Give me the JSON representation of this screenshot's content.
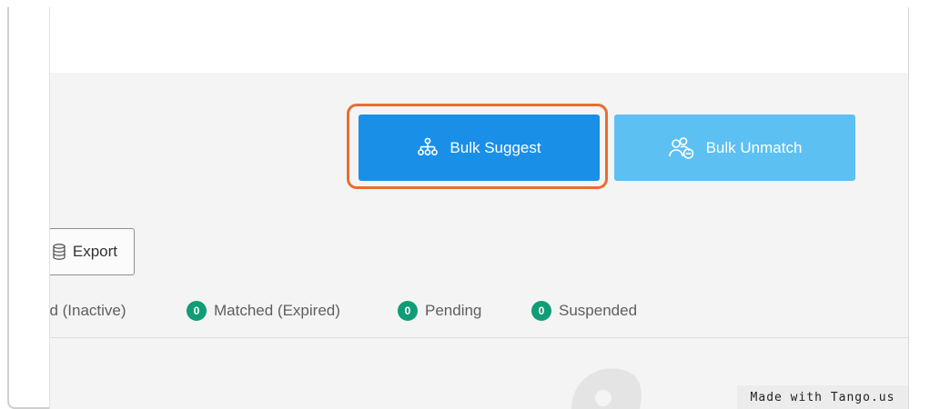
{
  "toolbar": {
    "bulk_suggest_label": "Bulk Suggest",
    "bulk_unmatch_label": "Bulk Unmatch",
    "export_label": "Export"
  },
  "status_filters": [
    {
      "label": "ed (Inactive)"
    },
    {
      "count": "0",
      "label": "Matched (Expired)"
    },
    {
      "count": "0",
      "label": "Pending"
    },
    {
      "count": "0",
      "label": "Suspended"
    }
  ],
  "footer": {
    "watermark_text": "Made with Tango.us"
  },
  "colors": {
    "primary_button": "#1a8fe8",
    "secondary_button": "#5cc0f3",
    "focus_ring": "#e96d31",
    "badge": "#0f9d77"
  },
  "icons": {
    "bulk_suggest": "hierarchy-icon",
    "bulk_unmatch": "users-remove-icon",
    "export": "database-icon"
  }
}
